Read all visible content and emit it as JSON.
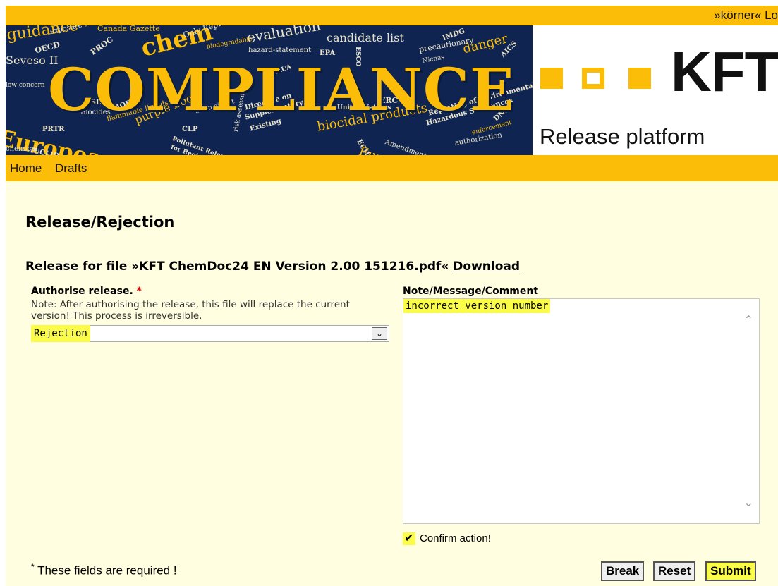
{
  "header": {
    "user_link": "»körner« Lo",
    "banner_title": "COMPLIANCE",
    "banner_words": [
      "guidance",
      "exposure scenario",
      "Canada Gazette",
      "chem",
      "Only Representative",
      "evaluation",
      "candidate list",
      "danger",
      "precautionary",
      "OECD",
      "PROC",
      "biodegradable",
      "hazard-statement",
      "EPA",
      "ESCO",
      "AICS",
      "Seveso II",
      "low concern",
      "DSL",
      "Biocides",
      "MOE",
      "flammable liquids",
      "purple book",
      "clean air act",
      "Directive on",
      "Supplementary",
      "Existing",
      "United Nations",
      "biocidal products",
      "ERC",
      "Reporting of Environmentally",
      "Hazardous Substances",
      "DNEL",
      "enforcement",
      "PRTR",
      "CLP",
      "Pollutant Release",
      "for Registration",
      "risk assessment",
      "authorization",
      "European Commission",
      "IUCLID",
      "chemical",
      "Amendments",
      "ECHA",
      "RAUA",
      "Europe",
      "Nicnas",
      "IMDG"
    ],
    "logo_text": "KFT",
    "platform_label": "Release platform"
  },
  "nav": {
    "items": [
      "Home",
      "Drafts"
    ]
  },
  "main": {
    "page_title": "Release/Rejection",
    "file_prefix": "Release for file »KFT ChemDoc24 EN Version 2.00 151216.pdf«",
    "download_label": "Download",
    "authorise_label": "Authorise release.",
    "required_marker": "*",
    "note_text": "Note: After authorising the release, this file will replace the current version! This process is irreversible.",
    "select_value": "Rejection",
    "comment_label": "Note/Message/Comment",
    "comment_value": "incorrect version number",
    "confirm_label": "Confirm action!",
    "required_note": "These fields are required !",
    "buttons": {
      "break": "Break",
      "reset": "Reset",
      "submit": "Submit"
    }
  },
  "colors": {
    "accent": "#fbbd08",
    "background": "#fffee0",
    "highlight": "#fbfb4a",
    "banner": "#0f2450"
  }
}
